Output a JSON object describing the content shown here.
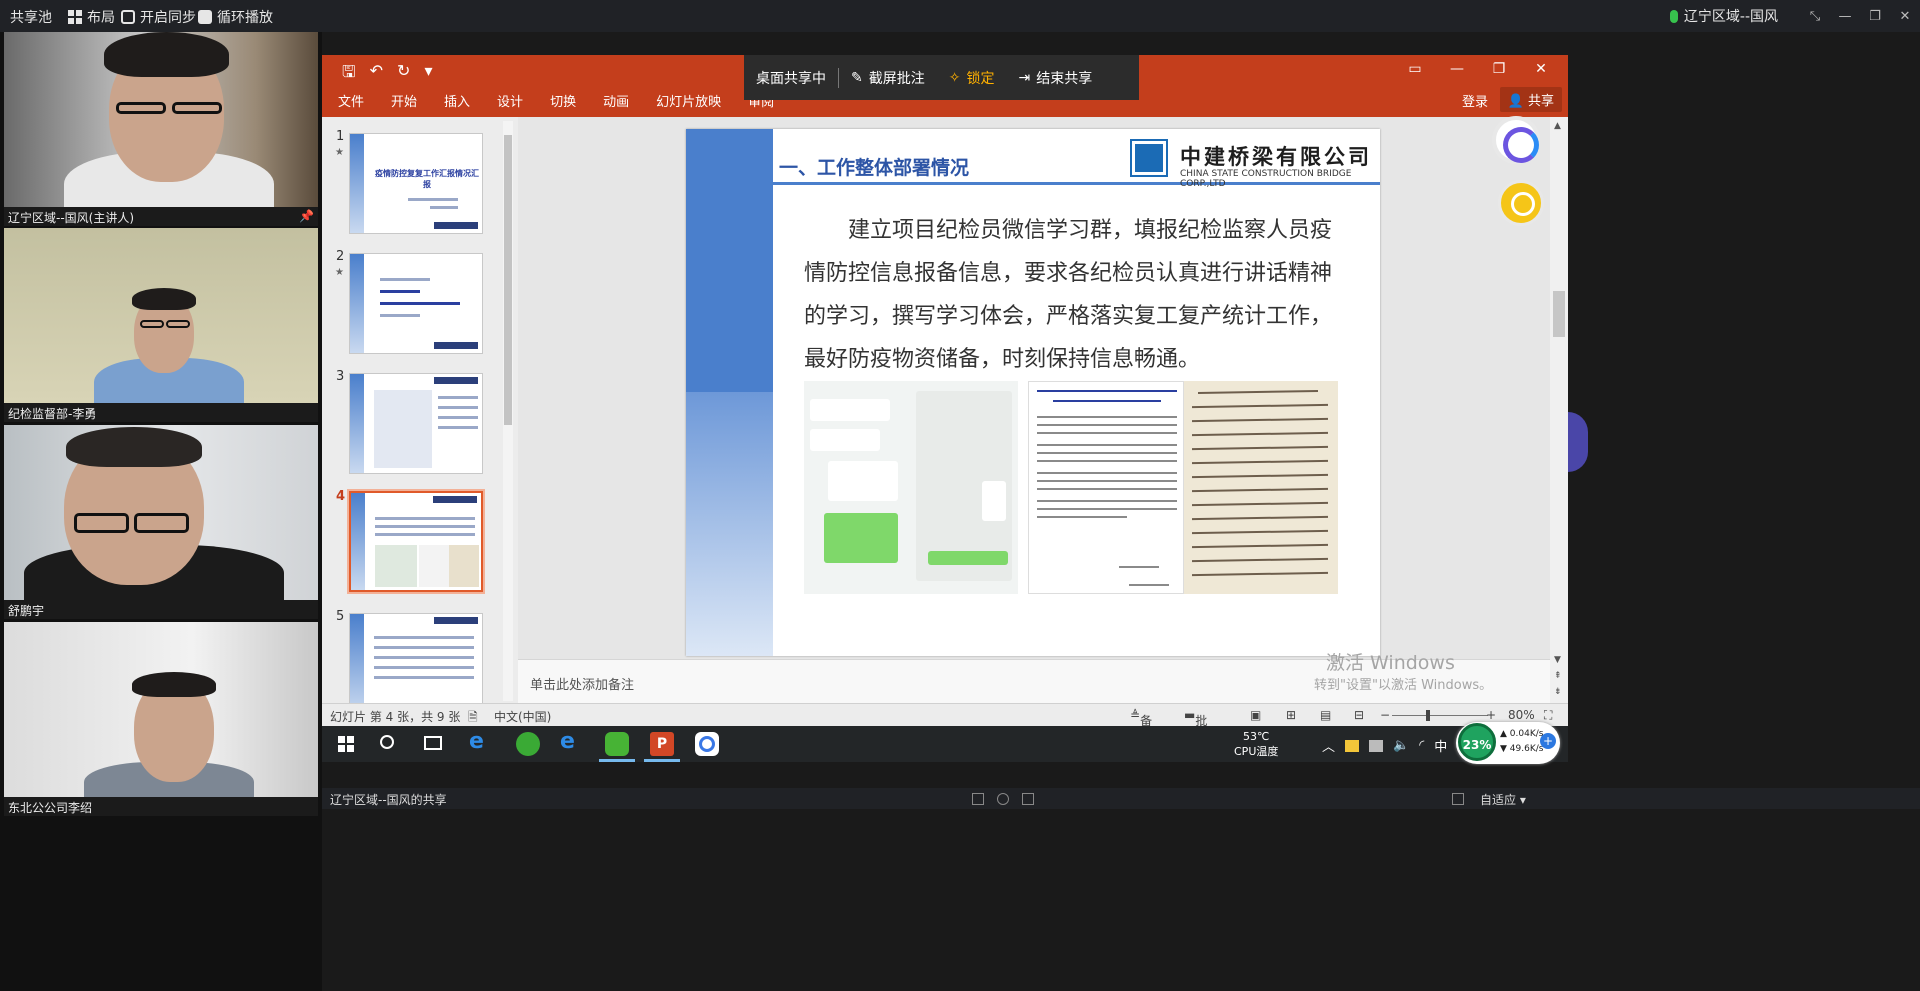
{
  "topbar": {
    "app_name": "共享池",
    "layout_label": "布局",
    "sync_label": "开启同步",
    "loop_label": "循环播放",
    "presenter": "辽宁区域--国风",
    "icons": [
      "grid-icon",
      "sync-icon",
      "loop-icon",
      "mic-icon"
    ]
  },
  "participants": [
    {
      "name": "辽宁区域--国风(主讲人)",
      "pinned": true
    },
    {
      "name": "纪检监督部-李勇"
    },
    {
      "name": "舒鹏宇"
    },
    {
      "name": "东北公公司李绍"
    }
  ],
  "sharebar": {
    "status": "桌面共享中",
    "annotate": "截屏批注",
    "lock": "锁定",
    "end": "结束共享"
  },
  "ribbon": {
    "menus": [
      "文件",
      "开始",
      "插入",
      "设计",
      "切换",
      "动画",
      "幻灯片放映",
      "审阅"
    ],
    "login": "登录",
    "share": "共享"
  },
  "thumbnails": [
    {
      "num": "1",
      "title": "疫情防控复复工作汇报情况汇 报"
    },
    {
      "num": "2",
      "title": ""
    },
    {
      "num": "3",
      "title": ""
    },
    {
      "num": "4",
      "title": "",
      "active": true
    },
    {
      "num": "5",
      "title": ""
    }
  ],
  "slide": {
    "heading": "一、工作整体部署情况",
    "company": "中建桥梁有限公司",
    "company_en": "CHINA STATE CONSTRUCTION BRIDGE CORP.,LTD",
    "body": "建立项目纪检员微信学习群，填报纪检监察人员疫情防控信息报备信息，要求各纪检员认真进行讲话精神的学习，撰写学习体会，严格落实复工复产统计工作，最好防疫物资储备，时刻保持信息畅通。"
  },
  "notes": {
    "placeholder": "单击此处添加备注",
    "watermark_title": "激活 Windows",
    "watermark_sub": "转到\"设置\"以激活 Windows。"
  },
  "status": {
    "slide_info": "幻灯片 第 4 张，共 9 张",
    "language": "中文(中国)",
    "notes_btn": "备注",
    "comments_btn": "批注",
    "zoom": "80%"
  },
  "taskbar": {
    "cpu_temp": "53℃",
    "cpu_label": "CPU温度",
    "ime": "中"
  },
  "network": {
    "percent": "23%",
    "up": "0.04K/s",
    "down": "49.6K/s"
  },
  "bottombar": {
    "share_title": "辽宁区域--国风的共享",
    "fit_label": "自适应"
  }
}
